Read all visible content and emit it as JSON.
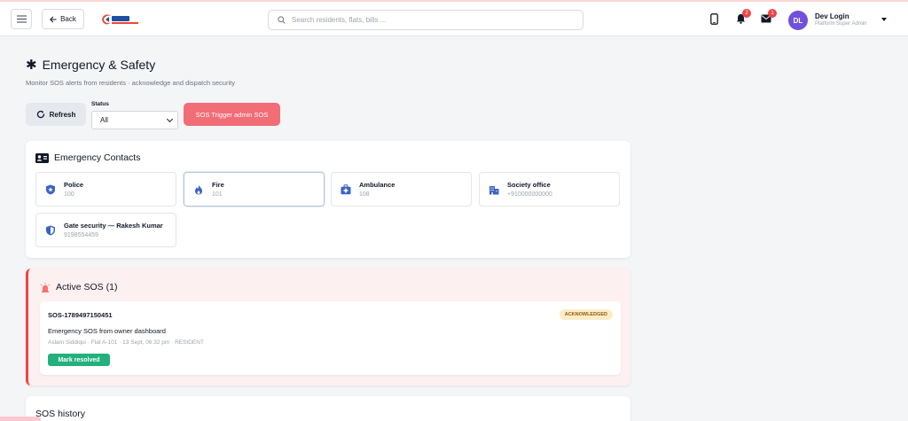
{
  "header": {
    "back_label": "Back",
    "search_placeholder": "Search residents, flats, bills ...",
    "notifications_count": "2",
    "messages_count": "1",
    "user": {
      "initials": "DL",
      "name": "Dev Login",
      "role": "Platform Super Admin"
    }
  },
  "page": {
    "title": "Emergency & Safety",
    "subtitle": "Monitor SOS alerts from residents · acknowledge and dispatch security"
  },
  "toolbar": {
    "refresh_label": "Refresh",
    "status_label": "Status",
    "status_value": "All",
    "sos_button_label": "SOS Trigger admin SOS"
  },
  "contacts": {
    "title": "Emergency Contacts",
    "items": [
      {
        "name": "Police",
        "phone": "100",
        "icon": "shield-star-icon"
      },
      {
        "name": "Fire",
        "phone": "101",
        "icon": "fire-icon"
      },
      {
        "name": "Ambulance",
        "phone": "108",
        "icon": "medical-kit-icon"
      },
      {
        "name": "Society office",
        "phone": "+910000000000",
        "icon": "building-icon"
      },
      {
        "name": "Gate security — Rakesh Kumar",
        "phone": "9198554459",
        "icon": "shield-half-icon"
      }
    ]
  },
  "active_sos": {
    "title": "Active SOS (1)",
    "items": [
      {
        "id": "SOS-1789497150451",
        "status": "ACKNOWLEDGED",
        "message": "Emergency SOS from owner dashboard",
        "meta": "Aslam Siddiqui · Flat A-101 · 13 Sept, 06:32 pm · RESIDENT",
        "action_label": "Mark resolved"
      }
    ]
  },
  "history": {
    "title": "SOS history"
  },
  "colors": {
    "primary": "#6f52d9",
    "danger": "#f26d76",
    "success": "#22b07d",
    "warning_bg": "#fdecc8",
    "alert_bg": "#fdf0f0"
  }
}
